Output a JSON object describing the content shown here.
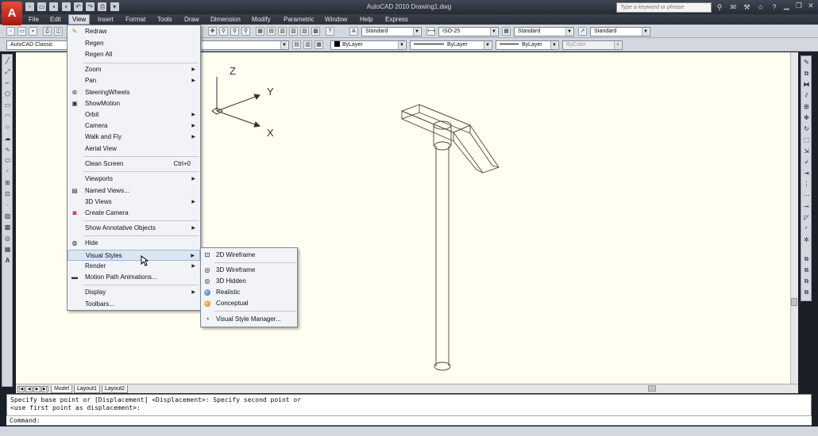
{
  "window": {
    "title": "AutoCAD 2010    Drawing1.dwg",
    "logo": "A"
  },
  "search": {
    "placeholder": "Type a keyword or phrase"
  },
  "menubar": [
    {
      "label": "File"
    },
    {
      "label": "Edit"
    },
    {
      "label": "View"
    },
    {
      "label": "Insert"
    },
    {
      "label": "Format"
    },
    {
      "label": "Tools"
    },
    {
      "label": "Draw"
    },
    {
      "label": "Dimension"
    },
    {
      "label": "Modify"
    },
    {
      "label": "Parametric"
    },
    {
      "label": "Window"
    },
    {
      "label": "Help"
    },
    {
      "label": "Express"
    }
  ],
  "toolbar": {
    "workspace": "AutoCAD Classic",
    "text_style": "Standard",
    "dim_style": "ISO-25",
    "table_style": "Standard",
    "multileader_style": "Standard",
    "color": "ByLayer",
    "linetype": "ByLayer",
    "lineweight": "ByLayer",
    "plotstyle": "ByColor"
  },
  "view_menu": {
    "items": [
      {
        "label": "Redraw",
        "icon": "pencil-icon",
        "submenu": false
      },
      {
        "label": "Regen",
        "submenu": false
      },
      {
        "label": "Regen All",
        "submenu": false
      },
      {
        "label": "Zoom",
        "submenu": true
      },
      {
        "label": "Pan",
        "submenu": true
      },
      {
        "label": "SteeringWheels",
        "icon": "steering-wheel-icon",
        "submenu": false
      },
      {
        "label": "ShowMotion",
        "icon": "showmotion-icon",
        "submenu": false
      },
      {
        "label": "Orbit",
        "submenu": true
      },
      {
        "label": "Camera",
        "submenu": true
      },
      {
        "label": "Walk and Fly",
        "submenu": true
      },
      {
        "label": "Aerial View",
        "submenu": false
      },
      {
        "label": "Clean Screen",
        "shortcut": "Ctrl+0",
        "submenu": false
      },
      {
        "label": "Viewports",
        "submenu": true
      },
      {
        "label": "Named Views...",
        "icon": "named-views-icon",
        "submenu": false
      },
      {
        "label": "3D Views",
        "submenu": true
      },
      {
        "label": "Create Camera",
        "icon": "camera-icon",
        "submenu": false
      },
      {
        "label": "Show Annotative Objects",
        "submenu": true
      },
      {
        "label": "Hide",
        "icon": "hide-icon",
        "submenu": false
      },
      {
        "label": "Visual Styles",
        "submenu": true,
        "highlighted": true
      },
      {
        "label": "Render",
        "submenu": true
      },
      {
        "label": "Motion Path Animations...",
        "icon": "motion-path-icon",
        "submenu": false
      },
      {
        "label": "Display",
        "submenu": true
      },
      {
        "label": "Toolbars...",
        "submenu": false
      }
    ]
  },
  "visual_styles_menu": {
    "items": [
      {
        "label": "2D Wireframe",
        "icon": "2d-wireframe-icon"
      },
      {
        "label": "3D Wireframe",
        "icon": "3d-wireframe-icon"
      },
      {
        "label": "3D Hidden",
        "icon": "3d-hidden-icon"
      },
      {
        "label": "Realistic",
        "icon": "realistic-icon"
      },
      {
        "label": "Conceptual",
        "icon": "conceptual-icon"
      },
      {
        "label": "Visual Style Manager...",
        "icon": "visual-style-manager-icon"
      }
    ]
  },
  "ucs": {
    "z": "Z",
    "y": "Y",
    "x": "X"
  },
  "layout_tabs": [
    {
      "label": "Model",
      "active": true
    },
    {
      "label": "Layout1"
    },
    {
      "label": "Layout2"
    }
  ],
  "command": {
    "history_1": "Specify base point or [Displacement] <Displacement>: Specify second point or",
    "history_2": "<use first point as displacement>:",
    "prompt": "Command:"
  },
  "colors": {
    "canvas": "#fffef0",
    "menu_highlight": "#dbe6f5",
    "realistic_ball": "#2f6fd0",
    "conceptual_ball": "#e8a23a"
  }
}
